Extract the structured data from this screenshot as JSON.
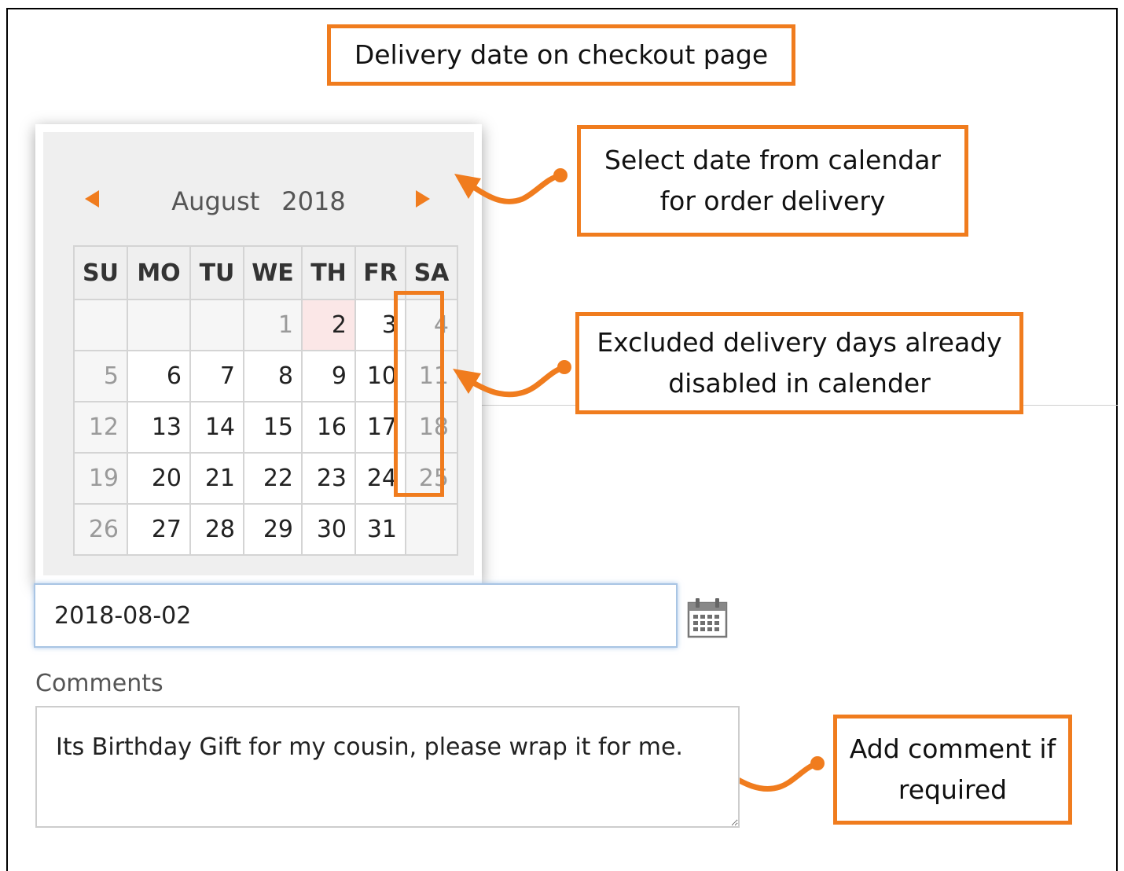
{
  "callouts": {
    "title": "Delivery date on checkout page",
    "select_date": "Select date from calendar\nfor order delivery",
    "excluded_days": "Excluded delivery days already\ndisabled in calender",
    "add_comment": "Add comment if\nrequired"
  },
  "calendar": {
    "month": "August",
    "year": "2018",
    "weekdays": [
      "SU",
      "MO",
      "TU",
      "WE",
      "TH",
      "FR",
      "SA"
    ],
    "weeks": [
      [
        "",
        "",
        "",
        "1",
        "2",
        "3",
        "4"
      ],
      [
        "5",
        "6",
        "7",
        "8",
        "9",
        "10",
        "11"
      ],
      [
        "12",
        "13",
        "14",
        "15",
        "16",
        "17",
        "18"
      ],
      [
        "19",
        "20",
        "21",
        "22",
        "23",
        "24",
        "25"
      ],
      [
        "26",
        "27",
        "28",
        "29",
        "30",
        "31",
        ""
      ]
    ],
    "disabled_days": [
      "1",
      "4",
      "5",
      "11",
      "12",
      "18",
      "19",
      "25",
      "26"
    ],
    "selected_day": "2"
  },
  "form": {
    "delivery_date_value": "2018-08-02",
    "comments_label": "Comments",
    "comments_value": "Its Birthday Gift for my cousin, please wrap it for me."
  },
  "colors": {
    "accent": "#f07c1e",
    "selected_day_bg": "#fbe7e7",
    "disabled_text": "#9a9a9a"
  },
  "icons": {
    "prev_month": "triangle-left-icon",
    "next_month": "triangle-right-icon",
    "date_picker": "calendar-icon"
  }
}
